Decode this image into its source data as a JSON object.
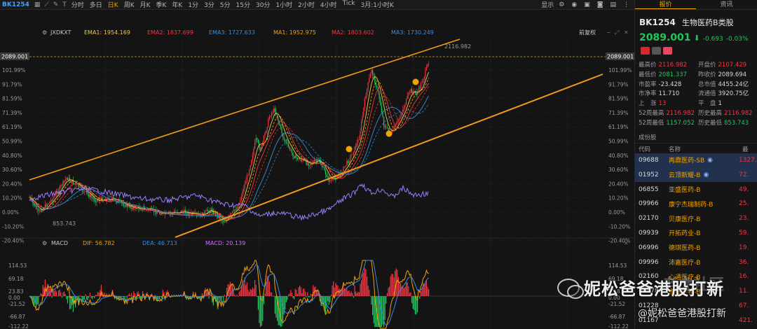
{
  "toolbar": {
    "code": "BK1254",
    "timeframes": [
      "分时",
      "多日",
      "日K",
      "周K",
      "月K",
      "季K",
      "年K",
      "1分",
      "3分",
      "5分",
      "15分",
      "30分",
      "1小时",
      "2小时",
      "4小时",
      "Tick",
      "3月:1小时K"
    ],
    "active_timeframe": "日K",
    "display": "显示",
    "icons": [
      "grid-icon",
      "line-icon",
      "pen-icon",
      "text-icon",
      "camera-icon",
      "settings-icon",
      "eye-icon",
      "lock-icon",
      "layout-icon",
      "more-icon"
    ]
  },
  "chart": {
    "main_indicator": "JXDKXT",
    "ema": [
      {
        "label": "EMA1: 1954.169",
        "color": "#f2c94c"
      },
      {
        "label": "EMA2: 1837.699",
        "color": "#f23645"
      },
      {
        "label": "EMA3: 1727.633",
        "color": "#3a8dde"
      }
    ],
    "ma": [
      {
        "label": "MA1: 1952.975",
        "color": "#f2a200"
      },
      {
        "label": "MA2: 1803.602",
        "color": "#f23645"
      },
      {
        "label": "MA3: 1730.249",
        "color": "#3a8dde"
      }
    ],
    "adjust": "前复权",
    "current_price_tag": "2089.001",
    "high_annotation": "2116.982",
    "low_annotation": "853.743",
    "percent_axis": [
      "101.99%",
      "91.79%",
      "81.59%",
      "71.39%",
      "61.19%",
      "50.99%",
      "40.80%",
      "30.60%",
      "20.40%",
      "10.20%",
      "0.00%",
      "-10.20%",
      "-20.40%"
    ],
    "percent_axis_top_cut": "112.19%",
    "colors": {
      "up": "#f23645",
      "down": "#21c55d",
      "channel": "#f29a1a",
      "purple_line": "#9b7bff",
      "price_line": "#d4a017"
    }
  },
  "macd": {
    "label": "MACD",
    "dif": "DIF: 56.782",
    "dea": "DEA: 46.713",
    "macd": "MACD: 20.139",
    "axis": [
      "114.53",
      "69.18",
      "23.83",
      "0.00",
      "-21.52",
      "-66.87",
      "-112.22"
    ],
    "colors": {
      "dif": "#f2a200",
      "dea": "#3a8dde",
      "macd": "#d36eff"
    }
  },
  "panel": {
    "tabs": [
      "报价",
      "资讯"
    ],
    "code": "BK1254",
    "name": "生物医药B类股",
    "price": "2089.001",
    "change": "-0.693",
    "change_pct": "-0.03%",
    "stats": [
      {
        "label": "最高价",
        "value": "2116.982",
        "color": "#f23645"
      },
      {
        "label": "开盘价",
        "value": "2107.429",
        "color": "#f23645"
      },
      {
        "label": "最低价",
        "value": "2081.337",
        "color": "#21c55d"
      },
      {
        "label": "昨收价",
        "value": "2089.694",
        "color": "#d8d8d8"
      },
      {
        "label": "市盈率",
        "value": "-23.428",
        "color": "#d8d8d8"
      },
      {
        "label": "总市值",
        "value": "4455.24亿",
        "color": "#d8d8d8"
      },
      {
        "label": "市净率",
        "value": "11.710",
        "color": "#d8d8d8"
      },
      {
        "label": "流通值",
        "value": "3920.75亿",
        "color": "#d8d8d8"
      },
      {
        "label": "上　涨",
        "value": "13",
        "color": "#f23645"
      },
      {
        "label": "平　盘",
        "value": "1",
        "color": "#d8d8d8"
      },
      {
        "label": "52周最高",
        "value": "2116.982",
        "color": "#f23645"
      },
      {
        "label": "历史最高",
        "value": "2116.982",
        "color": "#f23645"
      },
      {
        "label": "52周最低",
        "value": "1157.052",
        "color": "#21c55d"
      },
      {
        "label": "历史最低",
        "value": "853.743",
        "color": "#21c55d"
      }
    ],
    "constituents_title": "成份股",
    "col_code": "代码",
    "col_name": "名称",
    "col_price": "最",
    "constituents": [
      {
        "code": "09688",
        "name": "再鼎医药-SB",
        "price": "1327.",
        "eye": true,
        "sel": true
      },
      {
        "code": "01952",
        "name": "云顶新耀-B",
        "price": "72.",
        "eye": true,
        "sel": true
      },
      {
        "code": "06855",
        "name": "亚盛医药-B",
        "price": "49.",
        "eye": false,
        "sel": false
      },
      {
        "code": "09966",
        "name": "康宁杰瑞制药-B",
        "price": "25.",
        "eye": false,
        "sel": false
      },
      {
        "code": "02170",
        "name": "贝康医疗-B",
        "price": "23.",
        "eye": false,
        "sel": false
      },
      {
        "code": "09939",
        "name": "开拓药业-B",
        "price": "59.",
        "eye": false,
        "sel": false
      },
      {
        "code": "06996",
        "name": "德琪医药-B",
        "price": "19.",
        "eye": false,
        "sel": false
      },
      {
        "code": "09996",
        "name": "沛嘉医疗-B",
        "price": "36.",
        "eye": false,
        "sel": false
      },
      {
        "code": "02160",
        "name": "心通医疗-B",
        "price": "16.",
        "eye": false,
        "sel": false
      },
      {
        "code": "06978",
        "name": "永泰生物-B",
        "price": "11.",
        "eye": false,
        "sel": false
      },
      {
        "code": "01228",
        "name": "",
        "price": "67.",
        "eye": false,
        "sel": false
      },
      {
        "code": "01167",
        "name": "",
        "price": "421.",
        "eye": false,
        "sel": false
      },
      {
        "code": "01672",
        "name": "歌礼制药-B",
        "price": "",
        "eye": false,
        "sel": false
      }
    ]
  },
  "watermark": {
    "main": "妮松爸爸港股打新",
    "handle": "@妮松爸爸港股打新",
    "faint": "老虎社区"
  }
}
